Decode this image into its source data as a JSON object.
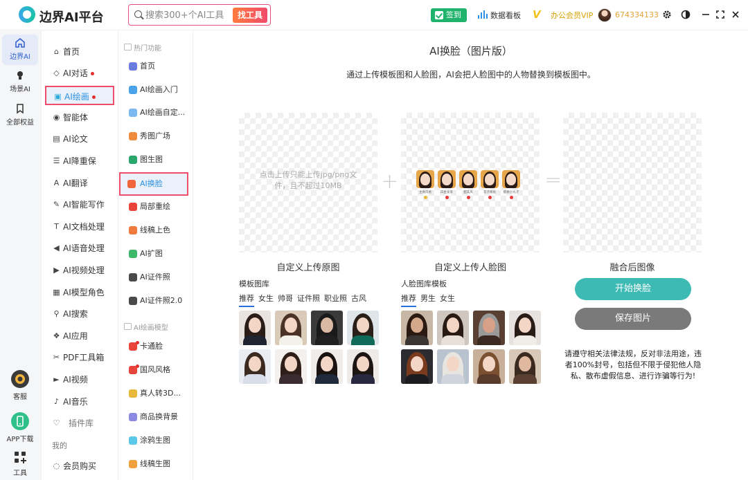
{
  "app": {
    "title": "边界AI平台",
    "user_id": "674334133"
  },
  "search": {
    "placeholder": "搜索300+个AI工具",
    "button": "找工具"
  },
  "topbar": {
    "signin": "签到",
    "dashboard": "数据看板",
    "vip": "办公会员VIP",
    "vip_badge": "V"
  },
  "rail": {
    "items": [
      {
        "label": "边界AI",
        "icon": "home-icon"
      },
      {
        "label": "场景AI",
        "icon": "bulb-icon"
      },
      {
        "label": "全部权益",
        "icon": "bookmark-icon"
      }
    ],
    "bottom": [
      {
        "label": "客服",
        "icon": "service-icon"
      },
      {
        "label": "APP下载",
        "icon": "phone-icon"
      },
      {
        "label": "工具",
        "icon": "grid-icon"
      }
    ]
  },
  "menu": {
    "items": [
      {
        "label": "首页",
        "icon": "⌂"
      },
      {
        "label": "AI对话",
        "icon": "◇",
        "dot": true
      },
      {
        "label": "AI绘画",
        "icon": "▣",
        "dot": true,
        "active": true
      },
      {
        "label": "智能体",
        "icon": "◉"
      },
      {
        "label": "AI论文",
        "icon": "▤"
      },
      {
        "label": "AI降重保",
        "icon": "☰"
      },
      {
        "label": "AI翻译",
        "icon": "A"
      },
      {
        "label": "AI智能写作",
        "icon": "✎"
      },
      {
        "label": "AI文档处理",
        "icon": "T"
      },
      {
        "label": "AI语音处理",
        "icon": "◀"
      },
      {
        "label": "AI视频处理",
        "icon": "▶"
      },
      {
        "label": "AI模型角色",
        "icon": "▦"
      },
      {
        "label": "AI搜索",
        "icon": "⚲"
      },
      {
        "label": "AI应用",
        "icon": "❖"
      },
      {
        "label": "PDF工具箱",
        "icon": "✂"
      },
      {
        "label": "AI视频",
        "icon": "►"
      },
      {
        "label": "AI音乐",
        "icon": "♪"
      },
      {
        "label": "插件库",
        "icon": "♡"
      }
    ],
    "section_mine": "我的",
    "purchase": "会员购买"
  },
  "submenu": {
    "head_hot": "热门功能",
    "head_model": "AI绘画模型",
    "items": [
      {
        "label": "首页",
        "color": "#6c7be0"
      },
      {
        "label": "AI绘画入门",
        "color": "#4aa3e8"
      },
      {
        "label": "AI绘画自定...",
        "color": "#7cb8f0"
      },
      {
        "label": "秀图广场",
        "color": "#f08a3c"
      },
      {
        "label": "图生图",
        "color": "#2aa86b"
      },
      {
        "label": "AI换脸",
        "color": "#f0653c",
        "active": true
      },
      {
        "label": "局部重绘",
        "color": "#e8443c"
      },
      {
        "label": "线稿上色",
        "color": "#f07a3c"
      },
      {
        "label": "AI扩图",
        "color": "#3cb868"
      },
      {
        "label": "AI证件照",
        "color": "#4a4a4a"
      },
      {
        "label": "AI证件照2.0",
        "color": "#4a4a4a"
      }
    ],
    "model_items": [
      {
        "label": "卡通脸",
        "color": "#e8443c",
        "dot": true
      },
      {
        "label": "国风风格",
        "color": "#e8443c",
        "dot": true
      },
      {
        "label": "真人转3D...",
        "color": "#e8b83c"
      },
      {
        "label": "商品换背景",
        "color": "#8a8ae0"
      },
      {
        "label": "涂鸦生图",
        "color": "#5ac8e8"
      },
      {
        "label": "线稿生图",
        "color": "#f0a03c"
      }
    ]
  },
  "main": {
    "title": "AI换脸（图片版）",
    "desc": "通过上传模板图和人脸图，AI会把人脸图中的人物替换到模板图中。",
    "upload_hint": "点击上传只能上传jpg/png文件，且不超过10MB",
    "plus": "+",
    "equals": "=",
    "label_original": "自定义上传原图",
    "label_face": "自定义上传人脸图",
    "label_result": "融合后图像",
    "face_strip": [
      "主要风格",
      "白金发系",
      "甜美风",
      "花子模板",
      "樱桃小丸子"
    ],
    "template_lib": {
      "title": "模板图库",
      "tabs": [
        "推荐",
        "女生",
        "帅哥",
        "证件照",
        "职业照",
        "古风"
      ]
    },
    "face_lib": {
      "title": "人脸图库模板",
      "tabs": [
        "推荐",
        "男生",
        "女生"
      ]
    },
    "start_button": "开始换脸",
    "save_button": "保存图片",
    "notice": "请遵守相关法律法规，反对非法用途，违者100%封号，包括但不限于侵犯他人隐私、散布虚假信息、进行诈骗等行为!"
  },
  "colors": {
    "accent": "#3dbab4",
    "highlight": "#ef4d6b",
    "active_text": "#2b8fe0"
  }
}
